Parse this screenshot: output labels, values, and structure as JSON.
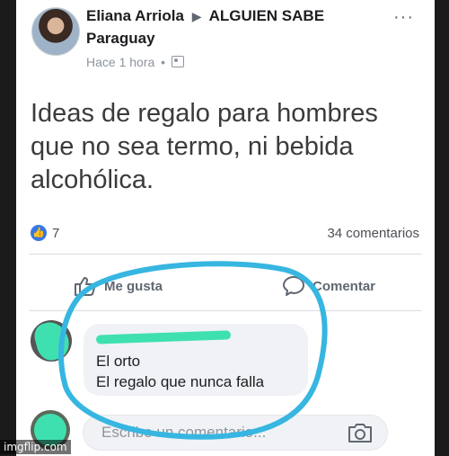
{
  "post": {
    "author": "Eliana Arriola",
    "group_line1": "ALGUIEN SABE",
    "group_line2": "Paraguay",
    "time": "Hace 1 hora",
    "separator": "•",
    "more_glyph": "···",
    "text": "Ideas de regalo para hombres que no sea termo, ni bebida alcohólica.",
    "reaction_count": "7",
    "comments_count": "34 comentarios"
  },
  "actions": {
    "like_label": "Me gusta",
    "comment_label": "Comentar"
  },
  "comment": {
    "line1": "El orto",
    "line2": "El regalo que nunca falla"
  },
  "composer": {
    "placeholder": "Escribe un comentario..."
  },
  "watermark": "imgflip.com",
  "colors": {
    "like_blue": "#3578e5",
    "annotation_circle": "#36b6e0",
    "redaction": "#3fe0b0"
  },
  "icons": {
    "privacy": "group-privacy-icon",
    "like": "thumbs-up-icon",
    "comment": "speech-bubble-icon",
    "camera": "camera-icon"
  }
}
